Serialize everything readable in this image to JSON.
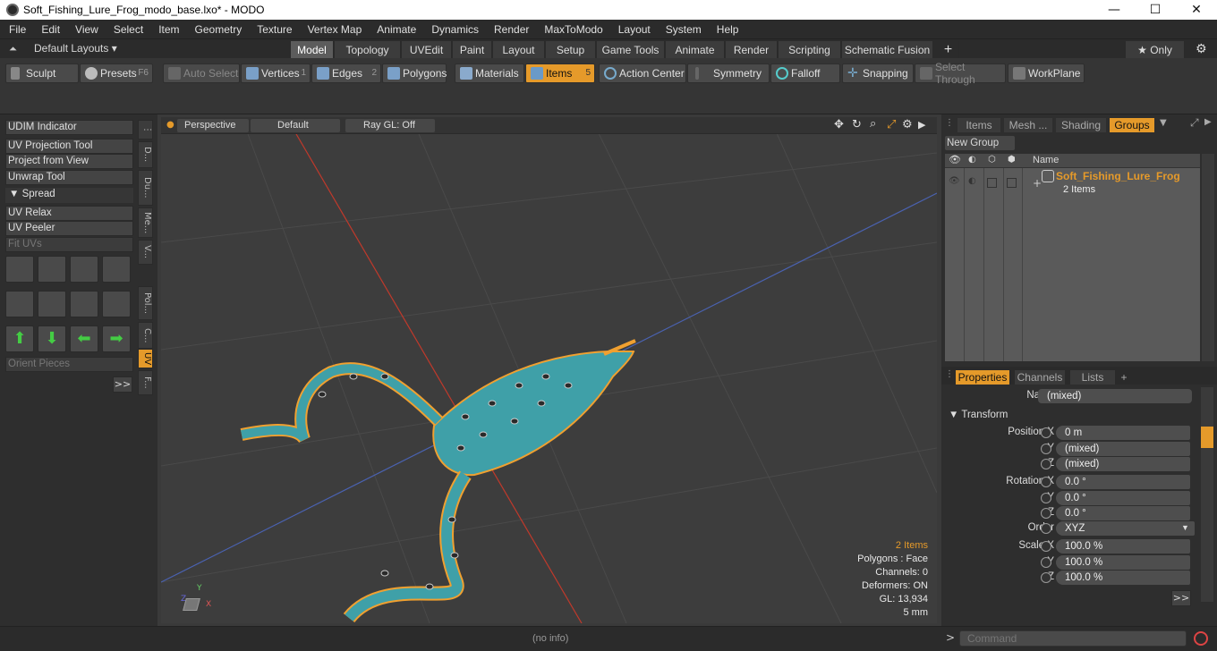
{
  "window": {
    "title": "Soft_Fishing_Lure_Frog_modo_base.lxo* - MODO",
    "minimize": "—",
    "maximize": "☐",
    "close": "✕"
  },
  "menu": [
    "File",
    "Edit",
    "View",
    "Select",
    "Item",
    "Geometry",
    "Texture",
    "Vertex Map",
    "Animate",
    "Dynamics",
    "Render",
    "MaxToModo",
    "Layout",
    "System",
    "Help"
  ],
  "layouts": {
    "dropdown": "Default Layouts ▾",
    "tabs": [
      "Model",
      "Topology",
      "UVEdit",
      "Paint",
      "Layout",
      "Setup",
      "Game Tools",
      "Animate",
      "Render",
      "Scripting",
      "Schematic Fusion",
      "+"
    ],
    "active": "Model",
    "only": "★ Only"
  },
  "toolbar": {
    "sculpt": "Sculpt",
    "presets": "Presets",
    "presets_key": "F6",
    "auto_select": "Auto Select",
    "vertices": "Vertices",
    "vertices_key": "1",
    "edges": "Edges",
    "edges_key": "2",
    "polygons": "Polygons",
    "materials": "Materials",
    "items": "Items",
    "items_key": "5",
    "action_center": "Action Center",
    "symmetry": "Symmetry",
    "falloff": "Falloff",
    "snapping": "Snapping",
    "select_through": "Select Through",
    "workplane": "WorkPlane"
  },
  "left": {
    "udim": "UDIM Indicator",
    "uv_projection": "UV Projection Tool",
    "project_view": "Project from View",
    "unwrap": "Unwrap Tool",
    "spread": "▼ Spread",
    "uv_relax": "UV Relax",
    "uv_peeler": "UV Peeler",
    "fit_uvs": "Fit UVs",
    "orient": "Orient Pieces",
    "more": ">>",
    "vtabs": [
      "D...",
      "Du...",
      "Me...",
      "V...",
      "Pol...",
      "C...",
      "UV",
      "F..."
    ]
  },
  "viewport": {
    "perspective": "Perspective",
    "default": "Default",
    "raygl": "Ray GL: Off",
    "info": {
      "items": "2 Items",
      "polygons": "Polygons : Face",
      "channels": "Channels: 0",
      "deformers": "Deformers: ON",
      "gl": "GL: 13,934",
      "scale": "5 mm"
    },
    "axes": {
      "x": "X",
      "y": "Y",
      "z": "Z"
    }
  },
  "right": {
    "tabs": [
      "Items",
      "Mesh ...",
      "Shading",
      "Groups"
    ],
    "active": "Groups",
    "new_group": "New Group",
    "col_name": "Name",
    "group_name": "Soft_Fishing_Lure_Frog",
    "group_sub": "2 Items",
    "ptabs": [
      "Properties",
      "Channels",
      "Lists",
      "+"
    ],
    "props": {
      "name_label": "Name",
      "name_val": "(mixed)",
      "transform": "▼ Transform",
      "pos_x": "Position X",
      "pos_x_v": "0 m",
      "y": "Y",
      "z": "Z",
      "pos_y_v": "(mixed)",
      "pos_z_v": "(mixed)",
      "rot_x": "Rotation X",
      "rot_x_v": "0.0 °",
      "rot_y_v": "0.0 °",
      "rot_z_v": "0.0 °",
      "order": "Order",
      "order_v": "XYZ",
      "scale_x": "Scale X",
      "sc_x_v": "100.0 %",
      "sc_y_v": "100.0 %",
      "sc_z_v": "100.0 %",
      "more": ">>"
    }
  },
  "status": {
    "info": "(no info)",
    "command": "Command"
  },
  "colors": {
    "accent": "#e59a2a",
    "wire": "#f0a030",
    "body": "#3fa0a8"
  }
}
